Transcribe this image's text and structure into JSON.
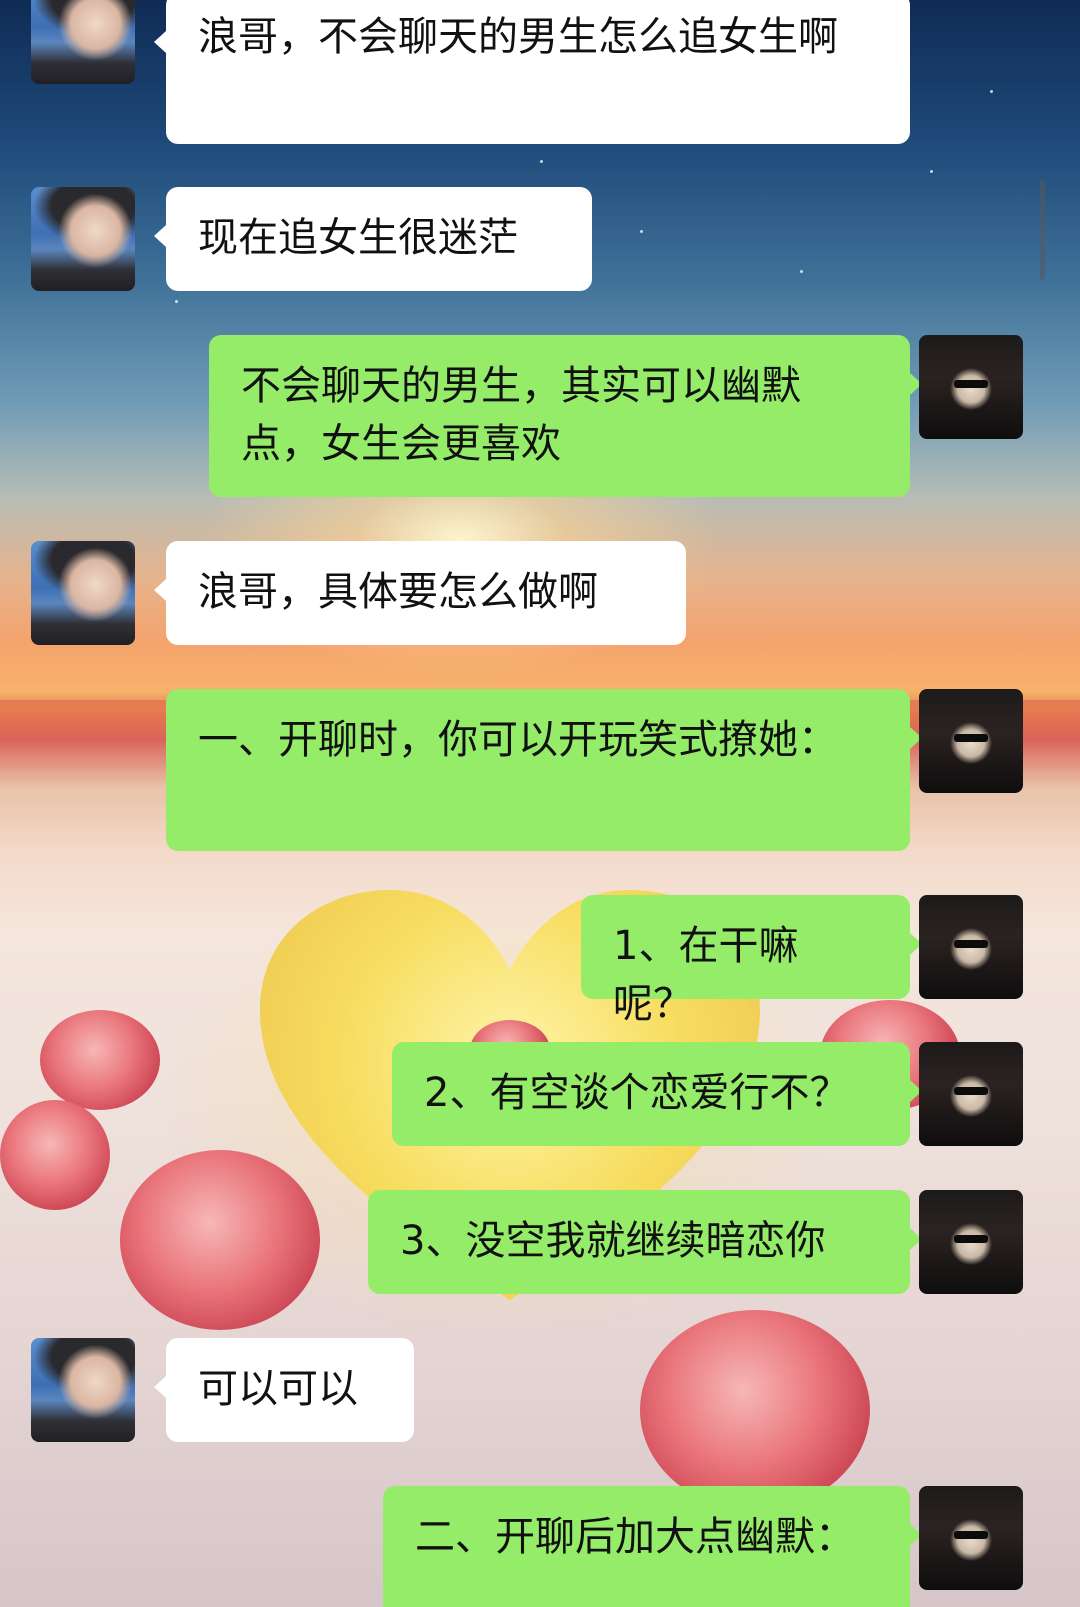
{
  "chat": {
    "messages": [
      {
        "side": "left",
        "text": "浪哥，不会聊天的男生怎么追女生啊"
      },
      {
        "side": "left",
        "text": "现在追女生很迷茫"
      },
      {
        "side": "right",
        "text": "不会聊天的男生，其实可以幽默点，女生会更喜欢"
      },
      {
        "side": "left",
        "text": "浪哥，具体要怎么做啊"
      },
      {
        "side": "right",
        "text": "一、开聊时，你可以开玩笑式撩她："
      },
      {
        "side": "right",
        "text": "1、在干嘛呢？"
      },
      {
        "side": "right",
        "text": "2、有空谈个恋爱行不？"
      },
      {
        "side": "right",
        "text": "3、没空我就继续暗恋你"
      },
      {
        "side": "left",
        "text": "可以可以"
      },
      {
        "side": "right",
        "text": "二、开聊后加大点幽默："
      }
    ]
  },
  "colors": {
    "sent_bubble": "#95ec69",
    "received_bubble": "#ffffff"
  }
}
